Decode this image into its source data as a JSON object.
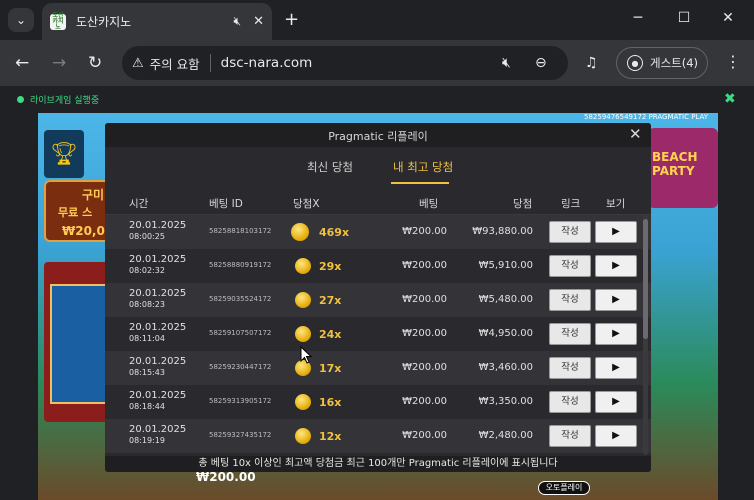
{
  "browser": {
    "tab_title": "도산카지노",
    "favicon_text": "도산\n카지노",
    "security_label": "주의 요함",
    "url": "dsc-nara.com",
    "profile_label": "게스트(4)"
  },
  "extension_bar": {
    "live_text": "라이브게임 실행중"
  },
  "game": {
    "id_text": "58259476549172  PRAGMATIC PLAY",
    "promo_line1": "구미",
    "promo_line2": "무료 스",
    "promo_line3": "₩20,0",
    "balance": "₩200.00",
    "autoplay_label": "오토플레이",
    "right_deco_text": "BEACH\nPARTY"
  },
  "modal": {
    "title": "Pragmatic 리플레이",
    "tabs": [
      {
        "label": "최신 당첨",
        "active": false
      },
      {
        "label": "내 최고 당첨",
        "active": true
      }
    ],
    "columns": {
      "time": "시간",
      "bet_id": "베팅 ID",
      "multiplier": "당첨X",
      "bet": "베팅",
      "win": "당첨",
      "link": "링크",
      "view": "보기"
    },
    "rows": [
      {
        "date": "20.01.2025",
        "time": "08:00:25",
        "bet_id": "58258818103172",
        "mult": "469x",
        "bet": "₩200.00",
        "win": "₩93,880.00",
        "link": "작성",
        "view": "▶"
      },
      {
        "date": "20.01.2025",
        "time": "08:02:32",
        "bet_id": "58258880919172",
        "mult": "29x",
        "bet": "₩200.00",
        "win": "₩5,910.00",
        "link": "작성",
        "view": "▶"
      },
      {
        "date": "20.01.2025",
        "time": "08:08:23",
        "bet_id": "58259035524172",
        "mult": "27x",
        "bet": "₩200.00",
        "win": "₩5,480.00",
        "link": "작성",
        "view": "▶"
      },
      {
        "date": "20.01.2025",
        "time": "08:11:04",
        "bet_id": "58259107507172",
        "mult": "24x",
        "bet": "₩200.00",
        "win": "₩4,950.00",
        "link": "작성",
        "view": "▶"
      },
      {
        "date": "20.01.2025",
        "time": "08:15:43",
        "bet_id": "58259230447172",
        "mult": "17x",
        "bet": "₩200.00",
        "win": "₩3,460.00",
        "link": "작성",
        "view": "▶"
      },
      {
        "date": "20.01.2025",
        "time": "08:18:44",
        "bet_id": "58259313905172",
        "mult": "16x",
        "bet": "₩200.00",
        "win": "₩3,350.00",
        "link": "작성",
        "view": "▶"
      },
      {
        "date": "20.01.2025",
        "time": "08:19:19",
        "bet_id": "58259327435172",
        "mult": "12x",
        "bet": "₩200.00",
        "win": "₩2,480.00",
        "link": "작성",
        "view": "▶"
      }
    ],
    "footer": "총 베팅 10x 이상인 최고액 당첨금 최근 100개만 Pragmatic 리플레이에 표시됩니다"
  }
}
